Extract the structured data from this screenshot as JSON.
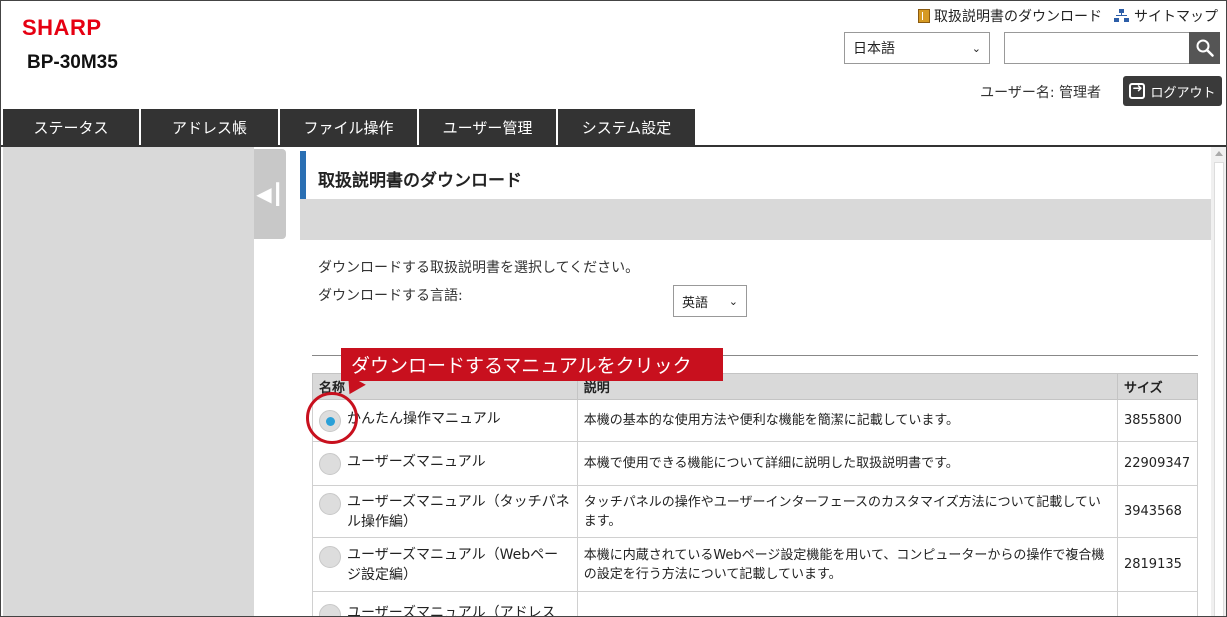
{
  "header": {
    "brand": "SHARP",
    "model": "BP-30M35",
    "top_links": [
      {
        "label": "取扱説明書のダウンロード",
        "icon": "manual-icon"
      },
      {
        "label": "サイトマップ",
        "icon": "sitemap-icon"
      }
    ],
    "ui_language": "日本語",
    "search_value": "",
    "user_label": "ユーザー名: 管理者",
    "logout_label": "ログアウト"
  },
  "tabs": [
    "ステータス",
    "アドレス帳",
    "ファイル操作",
    "ユーザー管理",
    "システム設定"
  ],
  "page": {
    "title": "取扱説明書のダウンロード",
    "instruction": "ダウンロードする取扱説明書を選択してください。",
    "language_label": "ダウンロードする言語:",
    "language_value": "英語"
  },
  "table": {
    "headers": {
      "name": "名称",
      "description": "説明",
      "size": "サイズ"
    },
    "rows": [
      {
        "name": "かんたん操作マニュアル",
        "description": "本機の基本的な使用方法や便利な機能を簡潔に記載しています。",
        "size": "3855800",
        "selected": true
      },
      {
        "name": "ユーザーズマニュアル",
        "description": "本機で使用できる機能について詳細に説明した取扱説明書です。",
        "size": "22909347",
        "selected": false
      },
      {
        "name": "ユーザーズマニュアル（タッチパネル操作編）",
        "description": "タッチパネルの操作やユーザーインターフェースのカスタマイズ方法について記載しています。",
        "size": "3943568",
        "selected": false
      },
      {
        "name": "ユーザーズマニュアル（Webページ設定編）",
        "description": "本機に内蔵されているWebページ設定機能を用いて、コンピューターからの操作で複合機の設定を行う方法について記載しています。",
        "size": "2819135",
        "selected": false
      },
      {
        "name": "ユーザーズマニュアル（アドレス",
        "description": "",
        "size": "",
        "selected": false
      }
    ]
  },
  "callout": {
    "text": "ダウンロードするマニュアルをクリック",
    "color": "#c8101e"
  },
  "colors": {
    "brand": "#e60012",
    "tab_bg": "#333333",
    "accent": "#2a6fb3",
    "radio_selected": "#2aa0d8"
  }
}
